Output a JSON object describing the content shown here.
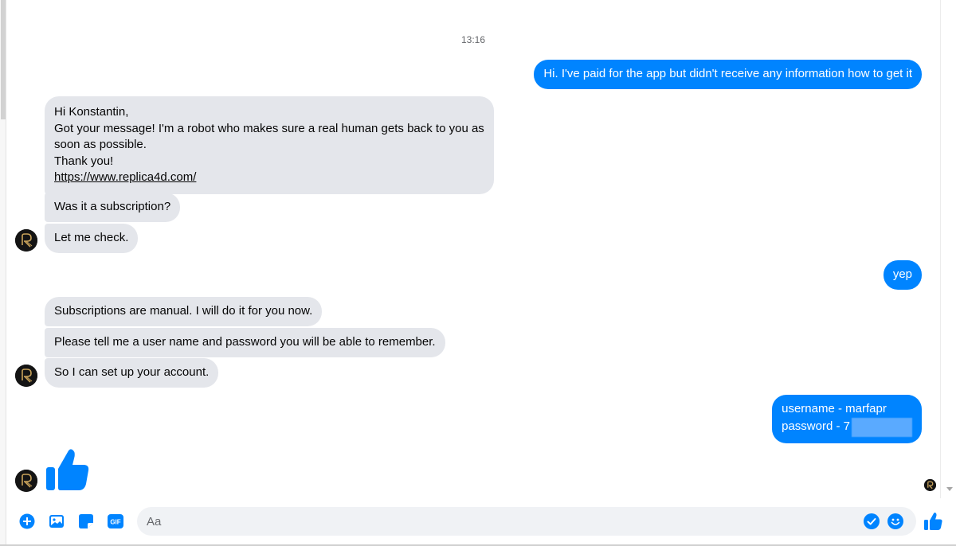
{
  "timestamp": "13:16",
  "messages": {
    "out_1": "Hi. I've paid for the app but didn't receive any information how to get it",
    "in_welcome": {
      "line1": "Hi Konstantin,",
      "line2": "Got your message! I'm a robot who makes sure a real human gets back to you as",
      "line3": "soon as possible.",
      "line4": "Thank you!",
      "link": "https://www.replica4d.com/"
    },
    "in_subscription": "Was it a subscription?",
    "in_check": "Let me check.",
    "out_yep": "yep",
    "in_manual": "Subscriptions are manual. I will do it for you now.",
    "in_tell": "Please tell me a user name and password you will be able to remember.",
    "in_setup": "So I can set up your account.",
    "out_credentials": {
      "line1": "username - marfapr",
      "line2": "password - 7"
    }
  },
  "composer": {
    "placeholder": "Aa",
    "gif_label": "GIF"
  },
  "colors": {
    "outgoing_bubble": "#0084ff",
    "incoming_bubble": "#e4e6eb",
    "accent": "#0084ff"
  },
  "icons": [
    "plus-icon",
    "photo-icon",
    "sticker-icon",
    "gif-icon",
    "check-circle-icon",
    "emoji-icon",
    "like-icon",
    "thumbs-up-icon"
  ]
}
